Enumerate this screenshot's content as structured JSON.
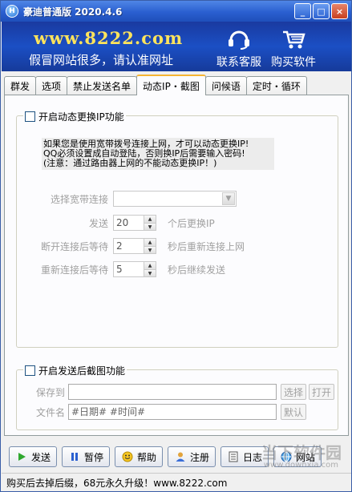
{
  "window": {
    "title": "豪迪普通版 2020.4.6",
    "minimize": "_",
    "maximize": "□",
    "close": "×"
  },
  "banner": {
    "url": "www.8222.com",
    "slogan": "假冒网站很多，请认准网址",
    "support_label": "联系客服",
    "buy_label": "购买软件"
  },
  "tabs": [
    {
      "label": "群发"
    },
    {
      "label": "选项"
    },
    {
      "label": "禁止发送名单"
    },
    {
      "label": "动态IP・截图",
      "active": true
    },
    {
      "label": "问候语"
    },
    {
      "label": "定时・循环"
    }
  ],
  "dynamic_ip": {
    "enable_label": "开启动态更换IP功能",
    "enabled": false,
    "note": "如果您是使用宽带拨号连接上网，才可以动态更换IP!\nQQ必须设置成自动登陆，否则换IP后需要输入密码!\n(注意：通过路由器上网的不能动态更换IP！)",
    "connection_label": "选择宽带连接",
    "connection_value": "",
    "send_label": "发送",
    "send_value": "20",
    "send_suffix": "个后更换IP",
    "wait_disconnect_label": "断开连接后等待",
    "wait_disconnect_value": "2",
    "wait_disconnect_suffix": "秒后重新连接上网",
    "wait_reconnect_label": "重新连接后等待",
    "wait_reconnect_value": "5",
    "wait_reconnect_suffix": "秒后继续发送"
  },
  "screenshot": {
    "enable_label": "开启发送后截图功能",
    "enabled": false,
    "save_to_label": "保存到",
    "save_to_value": "",
    "browse_label": "选择",
    "open_label": "打开",
    "filename_label": "文件名",
    "filename_value": "#日期# #时间#",
    "default_label": "默认"
  },
  "buttons": {
    "send": "发送",
    "pause": "暂停",
    "help": "帮助",
    "register": "注册",
    "log": "日志",
    "website": "网站"
  },
  "status": {
    "text": "购买后去掉后缀，68元永久升级！www.8222.com"
  },
  "watermark": {
    "text": "当下软件园",
    "sub": "www.downxia.com"
  }
}
